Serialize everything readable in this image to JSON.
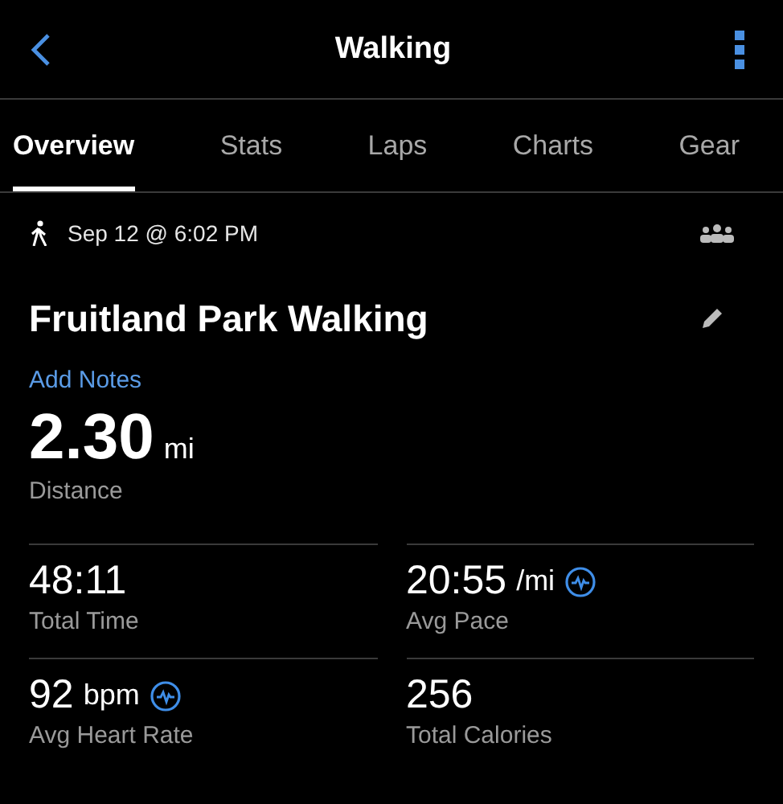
{
  "header": {
    "title": "Walking"
  },
  "tabs": [
    {
      "label": "Overview",
      "selected": true
    },
    {
      "label": "Stats",
      "selected": false
    },
    {
      "label": "Laps",
      "selected": false
    },
    {
      "label": "Charts",
      "selected": false
    },
    {
      "label": "Gear",
      "selected": false
    }
  ],
  "activity": {
    "date": "Sep 12 @ 6:02 PM",
    "name": "Fruitland Park Walking",
    "notes_link": "Add Notes"
  },
  "distance": {
    "value": "2.30",
    "unit": "mi",
    "label": "Distance"
  },
  "metrics": [
    {
      "value": "48:11",
      "label": "Total Time",
      "chart_icon": false
    },
    {
      "value": "20:55",
      "unit": "/mi",
      "label": "Avg Pace",
      "chart_icon": true
    },
    {
      "value": "92",
      "unit": "bpm",
      "label": "Avg Heart Rate",
      "chart_icon": true
    },
    {
      "value": "256",
      "label": "Total Calories",
      "chart_icon": false
    }
  ]
}
